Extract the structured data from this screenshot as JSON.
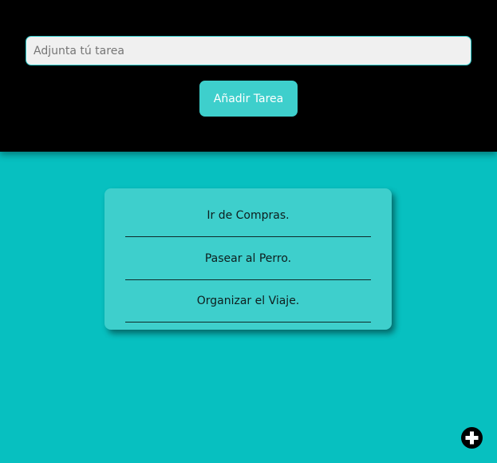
{
  "header": {
    "input_placeholder": "Adjunta tú tarea",
    "input_value": "",
    "add_button_label": "Añadir Tarea"
  },
  "tasks": [
    {
      "label": "Ir de Compras."
    },
    {
      "label": "Pasear al Perro."
    },
    {
      "label": "Organizar el Viaje."
    }
  ],
  "fab": {
    "icon": "plus-icon"
  },
  "colors": {
    "background": "#07c0c0",
    "header": "#000000",
    "accent": "#3ecfcc"
  }
}
